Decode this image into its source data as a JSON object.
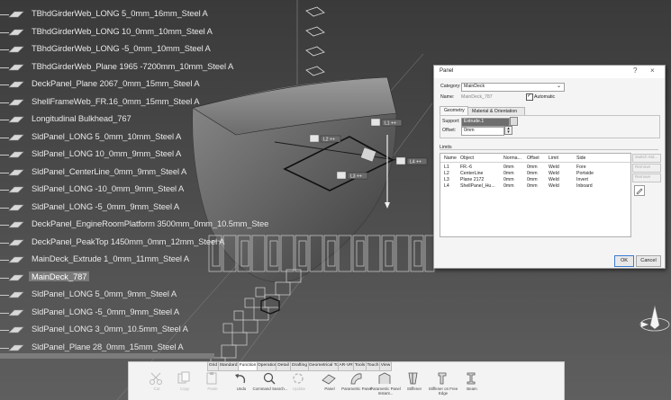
{
  "tree": {
    "items": [
      {
        "label": "TBhdGirderWeb_LONG 5_0mm_16mm_Steel A"
      },
      {
        "label": "TBhdGirderWeb_LONG 10_0mm_10mm_Steel A"
      },
      {
        "label": "TBhdGirderWeb_LONG -5_0mm_10mm_Steel A"
      },
      {
        "label": "TBhdGirderWeb_Plane 1965 -7200mm_10mm_Steel A"
      },
      {
        "label": "DeckPanel_Plane 2067_0mm_15mm_Steel A"
      },
      {
        "label": "ShellFrameWeb_FR.16_0mm_15mm_Steel A"
      },
      {
        "label": "Longitudinal Bulkhead_767"
      },
      {
        "label": "SldPanel_LONG 5_0mm_10mm_Steel A"
      },
      {
        "label": "SldPanel_LONG 10_0mm_9mm_Steel A"
      },
      {
        "label": "SldPanel_CenterLine_0mm_9mm_Steel A"
      },
      {
        "label": "SldPanel_LONG -10_0mm_9mm_Steel A"
      },
      {
        "label": "SldPanel_LONG -5_0mm_9mm_Steel A"
      },
      {
        "label": "DeckPanel_EngineRoomPlatform 3500mm_0mm_10.5mm_Stee"
      },
      {
        "label": "DeckPanel_PeakTop 1450mm_0mm_12mm_Steel A"
      },
      {
        "label": "MainDeck_Extrude 1_0mm_11mm_Steel A"
      },
      {
        "label": "MainDeck_787"
      },
      {
        "label": "SldPanel_LONG 5_0mm_9mm_Steel A"
      },
      {
        "label": "SldPanel_LONG -5_0mm_9mm_Steel A"
      },
      {
        "label": "SldPanel_LONG 3_0mm_10.5mm_Steel A"
      },
      {
        "label": "SldPanel_Plane 28_0mm_15mm_Steel A"
      }
    ],
    "selected_index": 15
  },
  "scene": {
    "annotations": [
      "L1 ++",
      "L2 ++",
      "L3 ++",
      "L4 ++"
    ]
  },
  "panel_dialog": {
    "title": "Panel",
    "help": "?",
    "close": "×",
    "category_label": "Category:",
    "category_value": "MainDeck",
    "name_label": "Name:",
    "name_value": "MainDeck_787",
    "automatic_label": "Automatic",
    "automatic_checked": true,
    "tabs": [
      "Geometry",
      "Material & Orientation"
    ],
    "support_label": "Support:",
    "support_value": "Extrude.1",
    "offset_label": "Offset:",
    "offset_value": "0mm",
    "limits_label": "Limits",
    "columns": [
      "Name",
      "Object",
      "Norma...",
      "Offset",
      "Limit",
      "Side"
    ],
    "rows": [
      {
        "name": "L1",
        "object": "FR.-6",
        "normal": "0mm",
        "offset": "0mm",
        "limit": "Weld",
        "side": "Fore"
      },
      {
        "name": "L2",
        "object": "CenterLine",
        "normal": "0mm",
        "offset": "0mm",
        "limit": "Weld",
        "side": "Portside"
      },
      {
        "name": "L3",
        "object": "Plane 2172",
        "normal": "0mm",
        "offset": "0mm",
        "limit": "Weld",
        "side": "Invert"
      },
      {
        "name": "L4",
        "object": "ShellPanel_Hu...",
        "normal": "0mm",
        "offset": "0mm",
        "limit": "Weld",
        "side": "Inboard"
      }
    ],
    "side_buttons": [
      "Switch Sid...",
      "Remove",
      "Remove"
    ],
    "ok_label": "OK",
    "cancel_label": "Cancel"
  },
  "toolbar": {
    "tabs": [
      "Grid",
      "Standard",
      "Function",
      "Operation",
      "Detail",
      "Drafting",
      "Geometrical Tools",
      "AR-VR",
      "Tools",
      "Touch",
      "View"
    ],
    "active_tab": "Function",
    "tools": [
      {
        "label": "Cut",
        "icon": "scissors-icon",
        "disabled": true
      },
      {
        "label": "Copy",
        "icon": "copy-icon",
        "disabled": true
      },
      {
        "label": "Paste",
        "icon": "paste-icon",
        "disabled": true
      },
      {
        "label": "Undo",
        "icon": "undo-icon",
        "disabled": false
      },
      {
        "label": "Command Search...",
        "icon": "command-search-icon",
        "disabled": false
      },
      {
        "label": "Update",
        "icon": "update-icon",
        "disabled": true
      },
      {
        "label": "Panel",
        "icon": "panel-icon",
        "disabled": false
      },
      {
        "label": "Parametric Panel",
        "icon": "parametric-panel-icon",
        "disabled": false
      },
      {
        "label": "Parametric Panel Instant...",
        "icon": "parametric-panel-instant-icon",
        "disabled": false
      },
      {
        "label": "Stiffener",
        "icon": "stiffener-icon",
        "disabled": false
      },
      {
        "label": "Stiffener on Free Edge",
        "icon": "stiffener-free-edge-icon",
        "disabled": false
      },
      {
        "label": "Beam",
        "icon": "beam-icon",
        "disabled": false
      }
    ]
  },
  "colors": {
    "background": "#474747",
    "tree_text": "#e8e8e8",
    "dialog_bg": "#f4f4f4",
    "selection": "#7a7a7a",
    "ok_border": "#3c7bd0"
  }
}
